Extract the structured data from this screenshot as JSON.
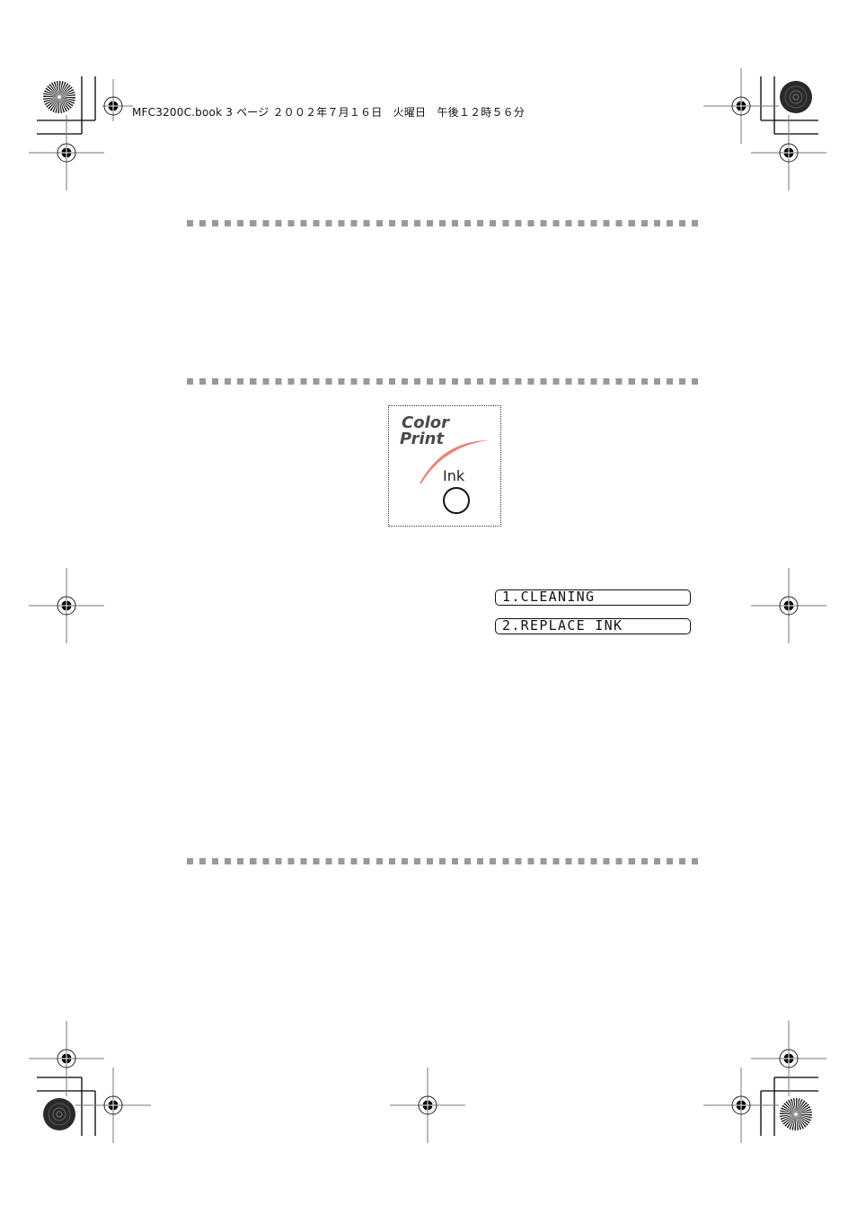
{
  "header": {
    "print_info": "MFC3200C.book  3 ページ  ２００２年７月１６日　火曜日　午後１２時５６分"
  },
  "ink_panel": {
    "logo_line1": "Color",
    "logo_line2": "Print",
    "button_label": "Ink",
    "accent_color": "#e8857a",
    "icon": "ink-button-icon"
  },
  "lcd_display": {
    "lines": [
      "1.CLEANING",
      "2.REPLACE INK"
    ]
  },
  "colors": {
    "rule": "#999999",
    "text": "#111111"
  }
}
